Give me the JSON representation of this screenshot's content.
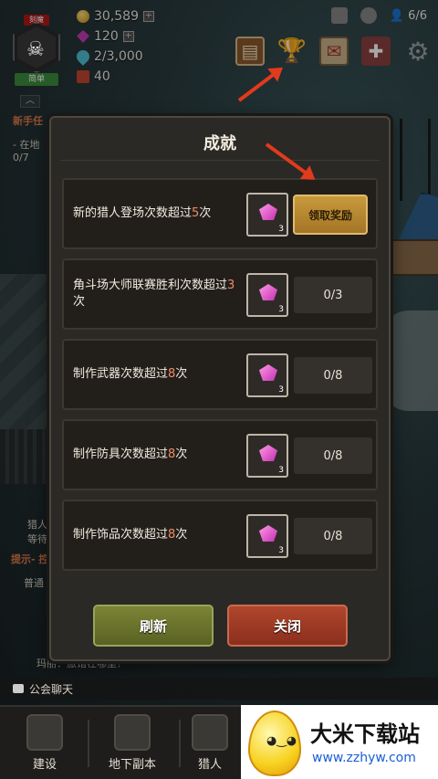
{
  "hud": {
    "rank_badge_top": "刻魔",
    "rank_label": "简单",
    "gold": "30,589",
    "gems": "120",
    "stamina": "2/3,000",
    "scrolls": "40",
    "population": "6/6"
  },
  "side": {
    "quest_header": "新手任",
    "quest_line1": "- 在地",
    "quest_line2": "0/7",
    "hunter_label1": "猎人",
    "hunter_label2": "等待",
    "hint": "提示- 控",
    "channel": "普通",
    "chat_preview": "玛丽：旅馆在哪里？"
  },
  "modal": {
    "title": "成就",
    "rows": [
      {
        "text_before": "新的猎人登场次数超过",
        "num": "5",
        "text_after": "次",
        "reward_count": "3",
        "action": "领取奖励",
        "claimable": true
      },
      {
        "text_before": "角斗场大师联赛胜利次数超过",
        "num": "3",
        "text_after": "次",
        "reward_count": "3",
        "progress": "0/3",
        "claimable": false
      },
      {
        "text_before": "制作武器次数超过",
        "num": "8",
        "text_after": "次",
        "reward_count": "3",
        "progress": "0/8",
        "claimable": false
      },
      {
        "text_before": "制作防具次数超过",
        "num": "8",
        "text_after": "次",
        "reward_count": "3",
        "progress": "0/8",
        "claimable": false
      },
      {
        "text_before": "制作饰品次数超过",
        "num": "8",
        "text_after": "次",
        "reward_count": "3",
        "progress": "0/8",
        "claimable": false
      }
    ],
    "refresh_label": "刷新",
    "close_label": "关闭"
  },
  "chat": {
    "label": "公会聊天"
  },
  "nav": {
    "build": "建设",
    "dungeon": "地下副本",
    "hunter": "猎人"
  },
  "promo": {
    "title": "大米下载站",
    "url": "www.zzhyw.com"
  },
  "colors": {
    "highlight": "#f08a63",
    "claim_button": "#c99a3c",
    "refresh_button": "#7b8436",
    "close_button": "#b0462c"
  }
}
